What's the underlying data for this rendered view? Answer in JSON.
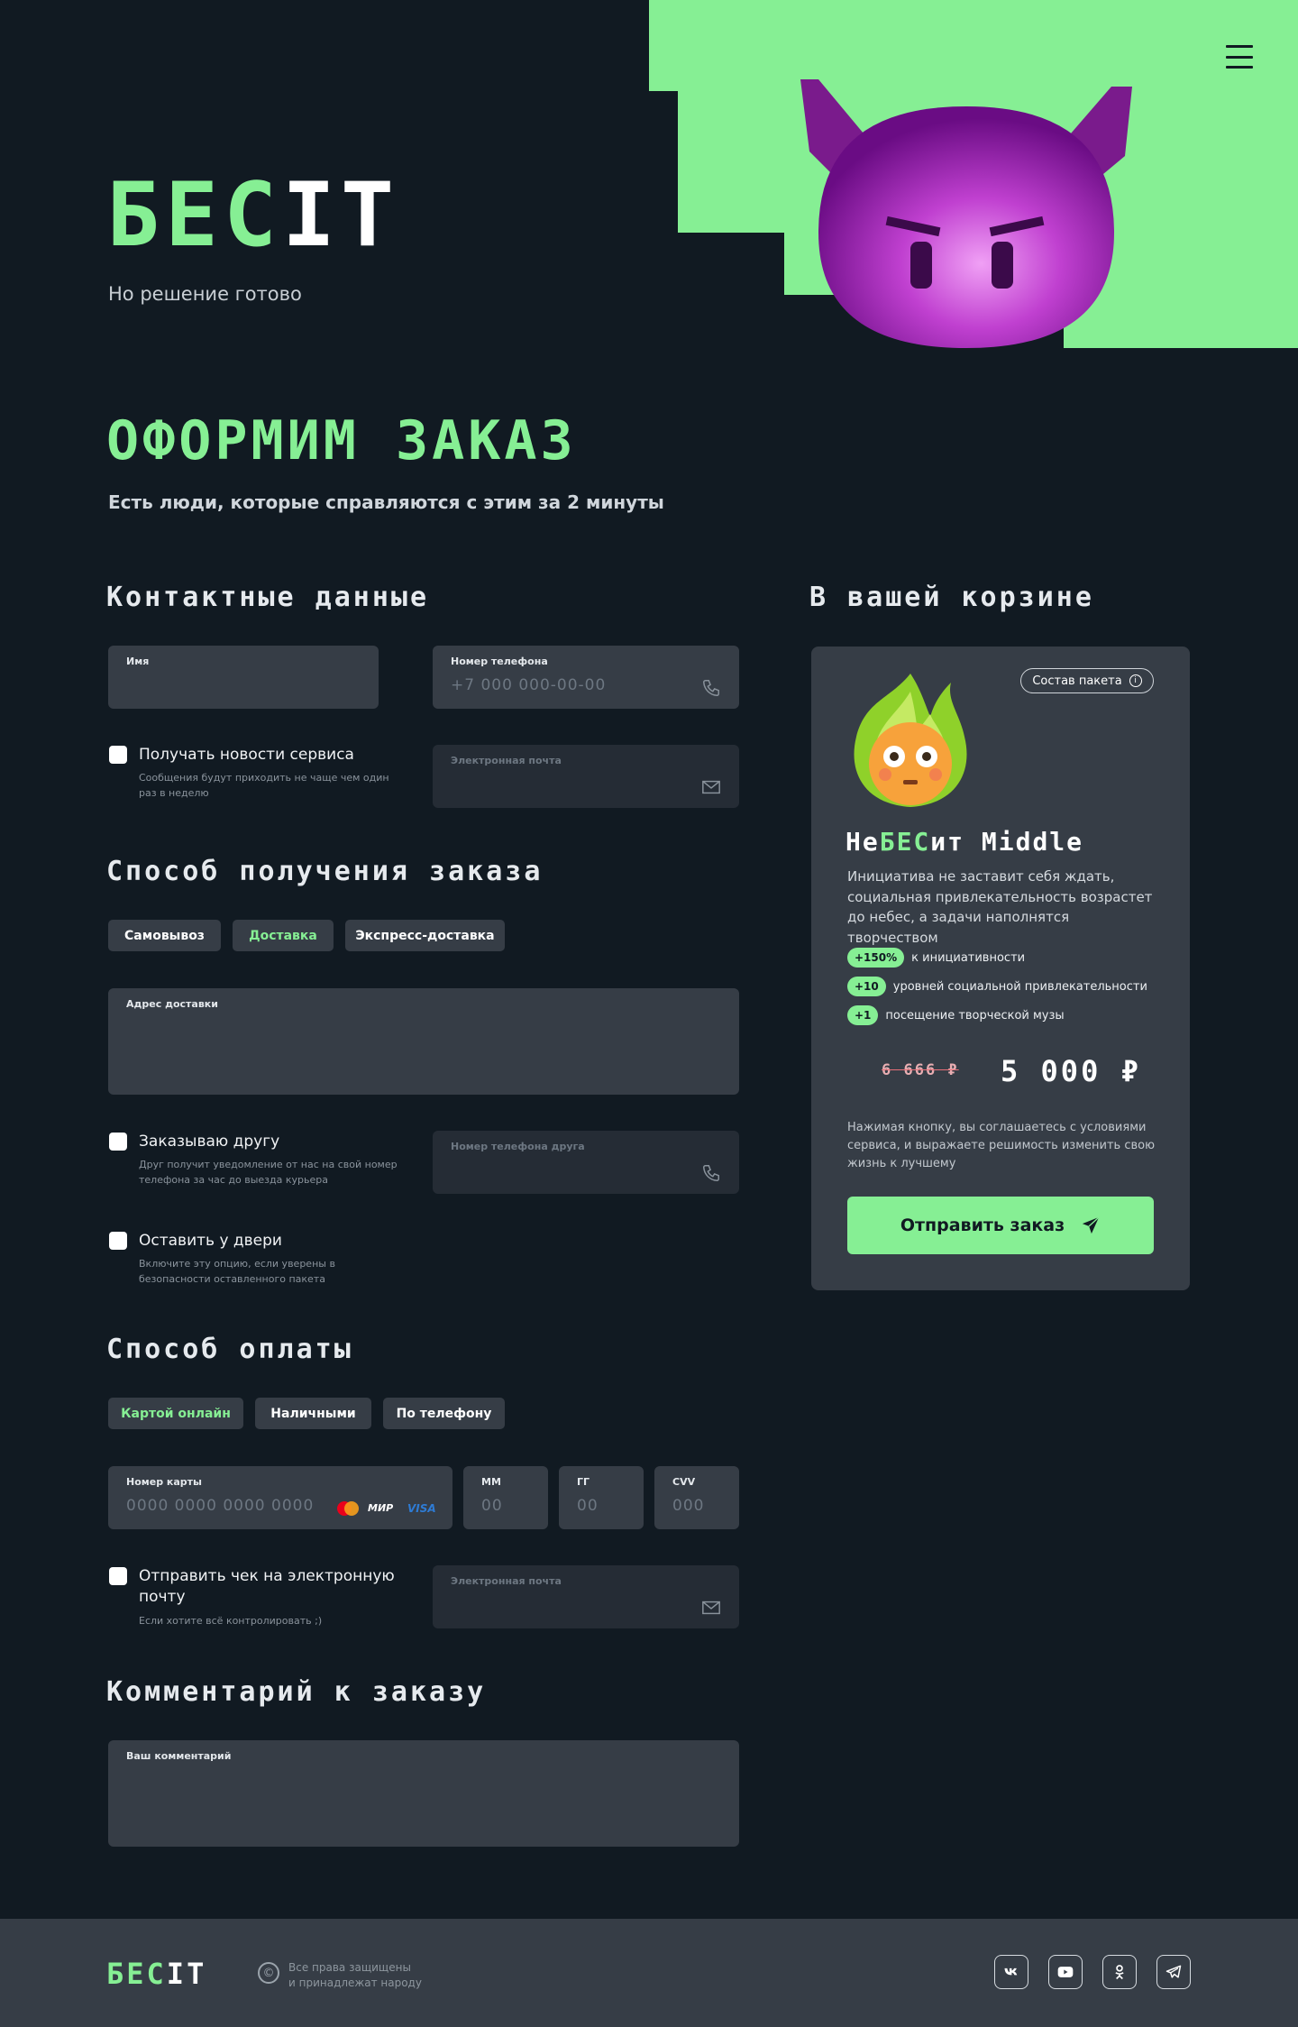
{
  "colors": {
    "bg": "#111a22",
    "accent": "#86ef94",
    "panel": "#363d46",
    "panel_dim": "#252c35"
  },
  "hero": {
    "logo_green": "БЕС",
    "logo_white": "IT",
    "subtitle": "Но решение готово",
    "menu_icon": "hamburger-icon",
    "mascot": "purple-devil-pixel"
  },
  "page": {
    "title": "ОФОРМИМ ЗАКАЗ",
    "subtitle": "Есть люди, которые справляются с этим за 2 минуты"
  },
  "contacts": {
    "title": "Контактные данные",
    "name_label": "Имя",
    "phone_label": "Номер телефона",
    "phone_placeholder": "+7 000 000-00-00",
    "news_title": "Получать новости сервиса",
    "news_note": "Сообщения будут приходить не чаще чем один раз в неделю",
    "email_label": "Электронная почта"
  },
  "delivery": {
    "title": "Способ получения заказа",
    "tabs": [
      "Самовывоз",
      "Доставка",
      "Экспресс-доставка"
    ],
    "active_tab": "Доставка",
    "address_label": "Адрес доставки",
    "friend_title": "Заказываю другу",
    "friend_note": "Друг получит уведомление от нас на свой номер телефона за час до выезда курьера",
    "friend_phone_label": "Номер телефона друга",
    "door_title": "Оставить у двери",
    "door_note": "Включите эту опцию, если уверены в безопасности оставленного пакета"
  },
  "payment": {
    "title": "Способ оплаты",
    "tabs": [
      "Картой онлайн",
      "Наличными",
      "По телефону"
    ],
    "active_tab": "Картой онлайн",
    "card_label": "Номер карты",
    "card_placeholder": "0000 0000 0000 0000",
    "card_brands": {
      "mir": "МИР",
      "visa": "VISA"
    },
    "mm_label": "ММ",
    "mm_placeholder": "00",
    "yy_label": "ГГ",
    "yy_placeholder": "00",
    "cvv_label": "CVV",
    "cvv_placeholder": "000",
    "receipt_title": "Отправить чек на электронную почту",
    "receipt_note": "Если хотите всё контролировать ;)",
    "email_label": "Электронная почта"
  },
  "comment": {
    "title": "Комментарий к заказу",
    "label": "Ваш комментарий"
  },
  "cart": {
    "title": "В вашей корзине",
    "pack_button": "Состав пакета",
    "product_prefix": "Не",
    "product_green": "БЕС",
    "product_suffix": "ит Middle",
    "description": "Инициатива не заставит себя ждать, социальная привлекательность возрастет до небес, а задачи наполнятся творчеством",
    "features": [
      {
        "badge": "+150%",
        "text": "к инициативности"
      },
      {
        "badge": "+10",
        "text": "уровней социальной привлекательности"
      },
      {
        "badge": "+1",
        "text": "посещение творческой музы"
      }
    ],
    "old_price": "6 666 ₽",
    "price": "5 000 ₽",
    "terms": "Нажимая кнопку, вы соглашаетесь с условиями сервиса, и выражаете решимость изменить свою жизнь к лучшему",
    "submit": "Отправить заказ"
  },
  "footer": {
    "logo_green": "БЕС",
    "logo_white": "IT",
    "copyright_symbol": "©",
    "rights_1": "Все права защищены",
    "rights_2": "и принадлежат народу",
    "social": [
      "vk-icon",
      "youtube-icon",
      "odnoklassniki-icon",
      "telegram-icon"
    ]
  }
}
